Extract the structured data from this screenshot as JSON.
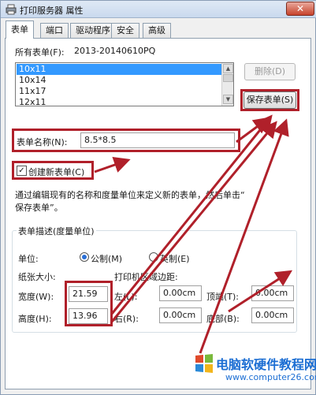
{
  "window": {
    "title": "打印服务器 属性",
    "close_symbol": "✕"
  },
  "tabs": [
    {
      "label": "表单"
    },
    {
      "label": "端口"
    },
    {
      "label": "驱动程序"
    },
    {
      "label": "安全"
    },
    {
      "label": "高级"
    }
  ],
  "forms": {
    "all_forms_label": "所有表单(F):",
    "server_name": "2013-20140610PQ",
    "items": [
      "10x11",
      "10x14",
      "11x17",
      "12x11"
    ],
    "selected": "10x11",
    "delete_label": "删除(D)",
    "save_label": "保存表单(S)"
  },
  "form_name": {
    "label": "表单名称(N):",
    "value": "8.5*8.5"
  },
  "create_new": {
    "label": "创建新表单(C)",
    "checked": true,
    "check_glyph": "✓"
  },
  "description": {
    "line1": "通过编辑现有的名称和度量单位来定义新的表单，然后单击“",
    "line2": "保存表单”。"
  },
  "measure": {
    "group_label": "表单描述(度量单位)",
    "units_label": "单位:",
    "metric_label": "公制(M)",
    "imperial_label": "英制(E)",
    "selected_unit": "metric",
    "paper_size_label": "纸张大小:",
    "margins_label": "打印机区域边距:",
    "width_label": "宽度(W):",
    "width_value": "21.59",
    "height_label": "高度(H):",
    "height_value": "13.96",
    "left_label": "左(L):",
    "left_value": "0.00cm",
    "right_label": "右(R):",
    "right_value": "0.00cm",
    "top_label": "顶端(T):",
    "top_value": "0.00cm",
    "bottom_label": "底部(B):",
    "bottom_value": "0.00cm"
  },
  "watermark": {
    "text": "电脑软硬件教程网",
    "url": "www.computer26.com"
  },
  "colors": {
    "annotation_red": "#b0202a",
    "selection_blue": "#3399ff"
  }
}
